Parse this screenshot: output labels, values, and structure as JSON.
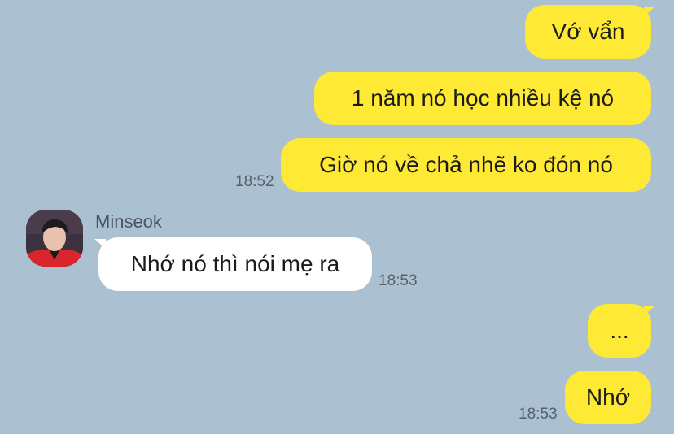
{
  "messages": [
    {
      "text": "Vớ vẩn"
    },
    {
      "text": "1 năm nó học nhiều kệ nó"
    },
    {
      "text": "Giờ nó về chả nhẽ ko đón nó",
      "time": "18:52"
    },
    {
      "sender": "Minseok",
      "text": "Nhớ nó thì nói mẹ ra",
      "time": "18:53"
    },
    {
      "text": "..."
    },
    {
      "text": "Nhớ",
      "time": "18:53"
    }
  ],
  "colors": {
    "background": "#abc1d1",
    "outgoing_bubble": "#fee934",
    "incoming_bubble": "#ffffff"
  }
}
